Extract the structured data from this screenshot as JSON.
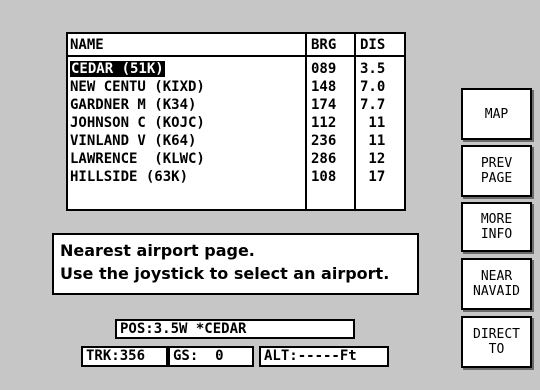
{
  "table": {
    "headers": {
      "name": "NAME",
      "brg": "BRG",
      "dis": "DIS"
    },
    "rows": [
      {
        "name": "CEDAR (51K)",
        "brg": "089",
        "dis": "3.5"
      },
      {
        "name": "NEW CENTU (KIXD)",
        "brg": "148",
        "dis": "7.0"
      },
      {
        "name": "GARDNER M (K34)",
        "brg": "174",
        "dis": "7.7"
      },
      {
        "name": "JOHNSON C (KOJC)",
        "brg": "112",
        "dis": " 11"
      },
      {
        "name": "VINLAND V (K64)",
        "brg": "236",
        "dis": " 11"
      },
      {
        "name": "LAWRENCE  (KLWC)",
        "brg": "286",
        "dis": " 12"
      },
      {
        "name": "HILLSIDE (63K)",
        "brg": "108",
        "dis": " 17"
      }
    ],
    "selected_index": 0
  },
  "message": {
    "line1": "Nearest airport page.",
    "line2": "Use the joystick to select an airport."
  },
  "status": {
    "pos": "POS:3.5W *CEDAR",
    "trk": "TRK:356",
    "gs": "GS:  0",
    "alt": "ALT:-----Ft"
  },
  "softkeys": {
    "map": {
      "line1": "MAP"
    },
    "prev_page": {
      "line1": "PREV",
      "line2": "PAGE"
    },
    "more_info": {
      "line1": "MORE",
      "line2": "INFO"
    },
    "near_navaid": {
      "line1": "NEAR",
      "line2": "NAVAID"
    },
    "direct_to": {
      "line1": "DIRECT",
      "line2": "TO"
    }
  }
}
